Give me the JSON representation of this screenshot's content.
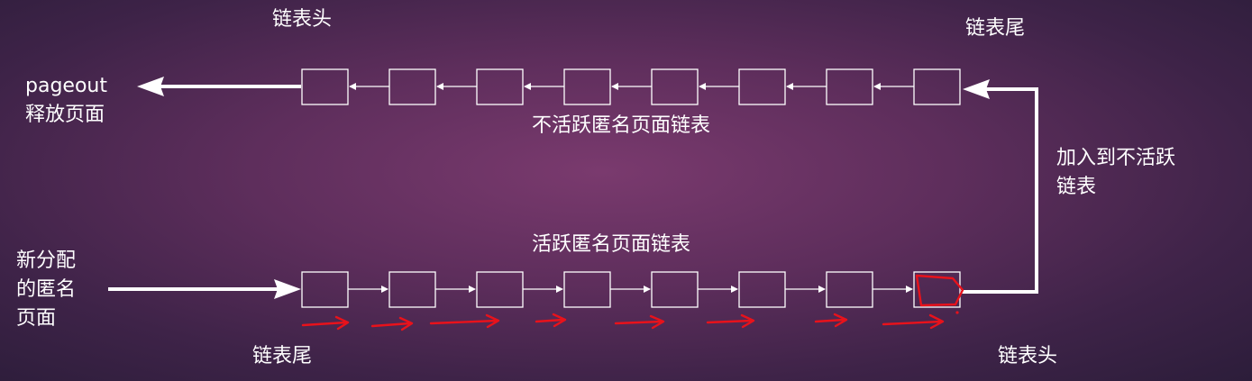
{
  "inactive_list": {
    "title": "不活跃匿名页面链表",
    "head_label": "链表头",
    "tail_label": "链表尾",
    "node_count": 8
  },
  "active_list": {
    "title": "活跃匿名页面链表",
    "head_label": "链表头",
    "tail_label": "链表尾",
    "node_count": 8
  },
  "pageout": {
    "line1": "pageout",
    "line2": "释放页面"
  },
  "new_pages": {
    "line1": "新分配",
    "line2": "的匿名",
    "line3": "页面"
  },
  "move_to_inactive": {
    "line1": "加入到不活跃",
    "line2": "链表"
  },
  "colors": {
    "annotation": "#e8121b",
    "lines": "#ffffff"
  }
}
